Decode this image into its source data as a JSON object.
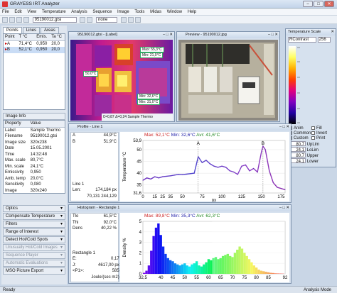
{
  "app": {
    "title": "GRAYESS IRT Analyzer",
    "min": "–",
    "max": "□",
    "close": "✕"
  },
  "menu": [
    "File",
    "Edit",
    "View",
    "Temperature",
    "Analysis",
    "Sequence",
    "Image",
    "Tools",
    "Midas",
    "Window",
    "Help"
  ],
  "toolbar": {
    "file": "95190012.gtsi",
    "zoom": "none"
  },
  "left": {
    "tabs": [
      "Points",
      "Lines",
      "Areas"
    ],
    "points": {
      "headers": [
        "Point",
        "T °C",
        "Emis.",
        "Ta °C"
      ],
      "rows": [
        [
          "A",
          "71,4°C",
          "0,950",
          "20,0"
        ],
        [
          "B",
          "52,1°C",
          "0,950",
          "20,0"
        ]
      ]
    },
    "info": {
      "title": "Image Info",
      "headers": [
        "Property",
        "Value"
      ],
      "rows": [
        [
          "Label",
          "Sample Thermo"
        ],
        [
          "Filename",
          "95190012.gtsi"
        ],
        [
          "Image size",
          "320x238"
        ],
        [
          "Date",
          "15.05.2001"
        ],
        [
          "Time",
          "14:32:48"
        ],
        [
          "Max. scale",
          "80,7°C"
        ],
        [
          "Min. scale",
          "24,1°C"
        ],
        [
          "Emissivity",
          "0,950"
        ],
        [
          "Amb. temp",
          "20,0°C"
        ],
        [
          "Sensitivity",
          "0,080"
        ],
        [
          "Image",
          "320x240"
        ]
      ]
    },
    "accordions": [
      {
        "label": "Optics",
        "dim": false
      },
      {
        "label": "Compensate Temperature",
        "dim": false
      },
      {
        "label": "Filters",
        "dim": false
      },
      {
        "label": "Range of Interest",
        "dim": false
      },
      {
        "label": "Detect Hot/Cold Spots",
        "dim": false
      },
      {
        "label": "Unusually Hot/Cold Images",
        "dim": true
      },
      {
        "label": "Sequence Player",
        "dim": true
      },
      {
        "label": "Automatic Evaluations",
        "dim": true
      },
      {
        "label": "MSO Picture Export",
        "dim": false
      }
    ]
  },
  "thermo": {
    "title": "95190012.gtsi - [Label]",
    "max": "Max: 55,3°C",
    "min1": "Min: 21,0°C",
    "spot": "50,0°C",
    "minA": "Min: 32,6°C",
    "minB": "Min: 31,0°C",
    "epsilon": "Ɛ=0,87",
    "ta": "Δ=0,24",
    "label": "Sample Thermo"
  },
  "preview": {
    "title": "Preview - 95190012.jpg"
  },
  "scale": {
    "title": "Temperature Scale",
    "mode": "RContrast",
    "n": "256",
    "checks": [
      [
        "Anim",
        "Fill"
      ],
      [
        "Common",
        "Invert"
      ],
      [
        "Custom",
        "Print"
      ]
    ],
    "rows": [
      [
        "80,7",
        "UpLim"
      ],
      [
        "24,1",
        "LoLim"
      ],
      [
        "80,7",
        "Upper"
      ],
      [
        "24,1",
        "Lower"
      ]
    ]
  },
  "profile": {
    "title": "Profile - Line 1",
    "info": [
      [
        "A",
        "44,9°C"
      ],
      [
        "B",
        "51,9°C"
      ]
    ],
    "footer": [
      [
        "Line 1",
        ""
      ],
      [
        "Len:",
        "174,184 px"
      ],
      [
        "",
        "70,131 244,129"
      ]
    ],
    "stats": {
      "max": "Max: 52,1°C",
      "min": "Min: 32,6°C",
      "avr": "Avr: 41,6°C"
    }
  },
  "histogram": {
    "title": "Histogram - Rectangle 1",
    "info": [
      [
        "Tlo",
        "61,5°C"
      ],
      [
        "Thi",
        "92,0°C"
      ],
      [
        "Dens",
        "40,22 %"
      ]
    ],
    "footer": [
      [
        "Rectangle 1",
        ""
      ],
      [
        "E:",
        "0,17"
      ],
      [
        "J:",
        "4617,00 px"
      ],
      [
        "<P1>:",
        "585"
      ],
      [
        "Joule/(sec m2)",
        ""
      ]
    ],
    "stats": {
      "max": "Max: 89,8°C",
      "min": "Min: 35,3°C",
      "avr": "Avr: 62,3°C"
    }
  },
  "status": {
    "left": "Ready",
    "right": "Analysis Mode"
  },
  "chart_data": [
    {
      "type": "line",
      "ylabel": "Temperature °C",
      "xlabel": "px",
      "xlim": [
        0,
        180
      ],
      "ylim": [
        31.6,
        53.9
      ],
      "yticks": [
        53.9,
        50,
        45,
        40,
        35,
        31.6
      ],
      "xticks": [
        0,
        15,
        25,
        35,
        50,
        75,
        100,
        125,
        150,
        175
      ],
      "markers": [
        {
          "label": "A",
          "x": 70
        },
        {
          "label": "B",
          "x": 152
        }
      ],
      "x": [
        0,
        5,
        10,
        15,
        20,
        25,
        30,
        35,
        40,
        45,
        50,
        55,
        60,
        65,
        70,
        75,
        80,
        85,
        90,
        95,
        100,
        105,
        110,
        115,
        120,
        125,
        130,
        135,
        140,
        145,
        150,
        152,
        155,
        160,
        165,
        170,
        175,
        180
      ],
      "y": [
        37,
        38,
        37.5,
        38.5,
        38,
        38.5,
        38.7,
        38.9,
        39.2,
        39.5,
        39.4,
        39.6,
        39.8,
        40,
        47,
        44.5,
        45.5,
        44,
        43,
        42.5,
        43,
        42.5,
        41,
        40.5,
        39.5,
        43,
        43.5,
        41,
        42,
        40.5,
        49,
        51.5,
        50,
        41,
        36,
        34,
        33.5,
        33
      ]
    },
    {
      "type": "bar",
      "ylabel": "Density %",
      "xlabel": "",
      "xlim": [
        32.5,
        92.0
      ],
      "ylim": [
        0,
        5
      ],
      "xticks": [
        32.5,
        40,
        45,
        50,
        55,
        60,
        65,
        70,
        75,
        80,
        85,
        92
      ],
      "yticks": [
        0,
        1,
        2,
        3,
        4,
        5
      ],
      "x": [
        33,
        34,
        35,
        36,
        37,
        38,
        39,
        40,
        41,
        42,
        43,
        44,
        45,
        46,
        47,
        48,
        49,
        50,
        51,
        52,
        53,
        54,
        55,
        56,
        57,
        58,
        59,
        60,
        61,
        62,
        63,
        64,
        65,
        66,
        67,
        68,
        69,
        70,
        71,
        72,
        73,
        74,
        75,
        76,
        77,
        78,
        79,
        80,
        81,
        82,
        83,
        84,
        85,
        86,
        87,
        88,
        89,
        90,
        91
      ],
      "values": [
        0.1,
        0.3,
        0.8,
        2.2,
        3.6,
        4.4,
        4.8,
        3.7,
        2.6,
        1.9,
        1.5,
        1.3,
        1.2,
        1.0,
        0.9,
        0.8,
        0.9,
        1.0,
        0.8,
        0.7,
        0.9,
        1.0,
        1.2,
        0.8,
        0.7,
        0.9,
        1.1,
        1.4,
        1.3,
        1.5,
        1.6,
        1.4,
        1.5,
        1.7,
        1.8,
        1.9,
        1.7,
        1.6,
        2.0,
        2.3,
        2.6,
        2.4,
        2.0,
        1.7,
        1.4,
        1.1,
        0.8,
        0.6,
        0.4,
        0.3,
        0.25,
        0.2,
        0.15,
        0.1,
        0.08,
        0.05,
        0.04,
        0.03,
        0.02
      ]
    }
  ]
}
